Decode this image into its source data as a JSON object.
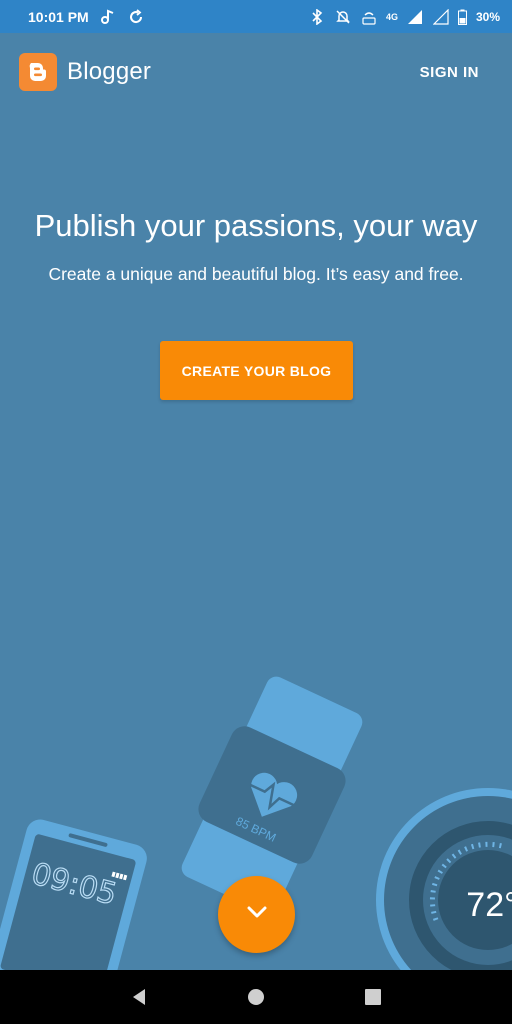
{
  "status_bar": {
    "time": "10:01 PM",
    "network": "4G",
    "battery": "30%"
  },
  "app_bar": {
    "brand": "Blogger",
    "sign_in": "SIGN IN"
  },
  "hero": {
    "title": "Publish your passions, your way",
    "subtitle": "Create a unique and beautiful blog. It’s easy and free.",
    "cta": "CREATE YOUR BLOG"
  },
  "illustrations": {
    "watch_bpm": "85 BPM",
    "phone_time": "09:05",
    "thermostat": "72°"
  },
  "colors": {
    "background": "#4a83a9",
    "status_bar": "#2f84c7",
    "accent": "#f98a06",
    "logo": "#f48a33"
  }
}
